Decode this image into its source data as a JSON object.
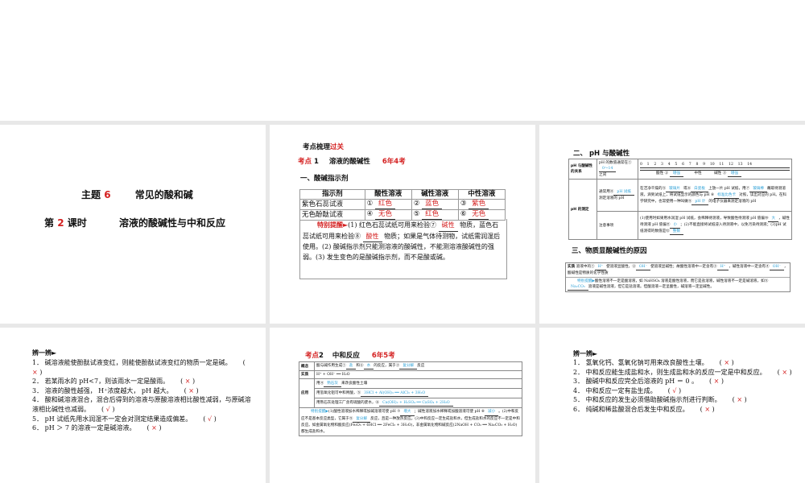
{
  "slides": {
    "s1": {
      "title_a": "主题",
      "title_num": "6",
      "title_b": "常见的酸和碱",
      "sub_a": "第",
      "sub_num": "2",
      "sub_b": "课时",
      "sub_c": "溶液的酸碱性与中和反应"
    },
    "s2": {
      "header_a": "考点梳理",
      "header_b": "过关",
      "kd_a": "考点",
      "kd_num": "1",
      "kd_title": "溶液的酸碱性",
      "kd_freq": "6年4考",
      "section": "一、酸碱指示剂",
      "table": {
        "headers": [
          "指示剂",
          "酸性溶液",
          "碱性溶液",
          "中性溶液"
        ],
        "rows": [
          {
            "name": "紫色石蕊试液",
            "c1n": "①",
            "c1": "红色",
            "c2n": "②",
            "c2": "蓝色",
            "c3n": "③",
            "c3": "紫色"
          },
          {
            "name": "无色酚酞试液",
            "c1n": "④",
            "c1": "无色",
            "c2n": "⑤",
            "c2": "红色",
            "c3n": "⑥",
            "c3": "无色"
          }
        ]
      },
      "note_label": "特别提醒►",
      "note_a": "(1) 红色石蕊试纸可用来检验⑦",
      "note_ans1": "碱性",
      "note_b": "物质，蓝色石蕊试纸可用来检验⑧",
      "note_ans2": "酸性",
      "note_c": "物质；如果是气体待测物，试纸需润湿后使用。(2) 酸碱指示剂只能测溶液的酸碱性，不能测溶液酸碱性的强弱。(3) 发生变色的是酸碱指示剂，而不是酸或碱。"
    },
    "s3": {
      "section1": "二、 pH 与酸碱性",
      "row1_head": "pH 与酸碱性的关系",
      "row1_text_a": "pH 的数值通常在①",
      "row1_ans": "0～14",
      "row1_text_b": "之间",
      "scale": "0 1 2 3 4 5 6 7 8 9 10 11 12 13 14",
      "scale_acid": "酸性 ②",
      "scale_acid_ans": "增强",
      "scale_neutral": "中性",
      "scale_base": "碱性 ③",
      "scale_base_ans": "增强",
      "row2_head": "pH 的测定",
      "row2_mid_a": "通常用④",
      "row2_mid_ans": "pH 试纸",
      "row2_mid_b": "测定溶液的 pH",
      "row2_text_a": "在洁净干燥的⑤",
      "row2_ans5": "玻璃片",
      "row2_text_b": "或⑥",
      "row2_ans6": "白瓷板",
      "row2_text_c": "上放一片 pH 试纸，用⑦",
      "row2_ans7": "玻璃棒",
      "row2_text_d": "蘸取待测溶液，滴到试纸上，将试纸显示的颜色与 pH ⑧",
      "row2_ans8": "标准比色卡",
      "row2_text_e": "对照，读出对应的 pH。在科学研究中，也常使用一种叫做⑨",
      "row2_ans9": "pH 计",
      "row2_text_f": "的电子仪器来测定溶液的 pH",
      "row3_mid": "注意事项",
      "row3_text_a": "(1)使用时如果用水润湿 pH 试纸，会稀释待测液，导致酸性待测液 pH 值偏⑩",
      "row3_ans10": "大",
      "row3_text_b": "，碱性待测液 pH 值偏⑪",
      "row3_ans11": "小",
      "row3_text_c": "；(2)不能直接将试纸浸入待测液中，以免污染待测液；(3)pH 试纸测得的数值是⑫",
      "row3_ans12": "整数",
      "section2": "三、物质显酸碱性的原因",
      "essence_head": "实质",
      "essence_a": "溶液中的①",
      "ans1": "H⁺",
      "essence_b": "使溶液显酸性，②",
      "ans2": "OH⁻",
      "essence_c": "使溶液显碱性；故酸性溶液中一定含有③",
      "ans3": "H⁺",
      "essence_d": "，碱性溶液中一定含有④",
      "ans4": "OH⁻",
      "essence_e": "，酸碱性是物质的化学性质",
      "tip_label": "特别提醒▶",
      "tip_a": "酸性溶液不一定是酸溶液，如 NaHSO₄ 溶液是酸性溶液，而它是盐溶液，碱性溶液不一定是碱溶液，如⑤",
      "tip_ans": "Na₂CO₃",
      "tip_b": "溶液是碱性溶液，但它是盐溶液。但酸溶液一定呈酸性，碱溶液一定呈碱性。"
    },
    "s4": {
      "title": "辨一辨►",
      "items": [
        {
          "text": "1． 碱溶液能使酚酞试液变红，则能使酚酞试液变红的物质一定是碱。",
          "mark": "×"
        },
        {
          "text": "2． 若某雨水的 pH<7，则该雨水一定是酸雨。",
          "mark": "×"
        },
        {
          "text": "3． 溶液的酸性越强， H⁺浓度越大， pH 越大。",
          "mark": "×"
        },
        {
          "text": "4． 酸和碱溶液混合，混合后得到的溶液与原酸溶液相比酸性减弱，与原碱溶液相比碱性也减弱。",
          "mark": "√"
        },
        {
          "text": "5． pH 试纸先用水润湿不一定会对测定结果造成偏差。",
          "mark": "√"
        },
        {
          "text": "6． pH ＞ 7 的溶液一定是碱溶液。",
          "mark": "×"
        }
      ]
    },
    "s5": {
      "kd_a": "考点",
      "kd_num": "2",
      "kd_title": "中和反应",
      "kd_freq": "6年5考",
      "concept_head": "概念",
      "concept_a": "酸与碱作用生成①",
      "ans1": "盐",
      "concept_b": "和②",
      "ans2": "水",
      "concept_c": "的反应，属于③",
      "ans3": "复分解",
      "concept_d": "反应",
      "essence_head": "实质",
      "essence": "H⁺ + OH⁻ ══ H₂O",
      "apply_head": "应用",
      "apply1_a": "用④",
      "apply1_ans": "熟石灰",
      "apply1_b": "来改良酸性土壤",
      "apply2_a": "用氢氧化铝可中和胃酸，⑤",
      "apply2_ans": "3HCl + Al(OH)₃ ══ AlCl₃ + 3H₂O",
      "apply3_a": "用熟石灰处理工厂含有硫酸的废水，⑥",
      "apply3_ans": "Ca(OH)₂ + H₂SO₄ ══ CaSO₄ + 2H₂O",
      "tip_label": "特别提醒▶",
      "tip_a": "(1)酸性溶液加水稀释或加碱溶液可使 pH ⑦",
      "tip_ans7": "增大",
      "tip_b": "；碱性溶液加水稀释或加酸溶液可使 pH ⑧",
      "tip_ans8": "减小",
      "tip_c": "。(2)中和反应不是基本反应类型，它属于⑨",
      "tip_ans9": "复分解",
      "tip_d": "反应，且是一种放热反应。(3)中和反应一定生成盐和水，但生成盐和水的反应不一定是中和反应。如金属氧化物和酸反应(Fe₂O₃ + 6HCl ══ 2FeCl₃ + 3H₂O)，非金属氧化物和碱反应(2NaOH + CO₂ ══ Na₂CO₃ + H₂O)都生成盐和水。"
    },
    "s6": {
      "title": "辨一辨►",
      "items": [
        {
          "text": "1． 氢氧化钙、氢氧化钠可用来改良酸性土壤。",
          "mark": "×"
        },
        {
          "text": "2． 中和反应能生成盐和水，则生成盐和水的反应一定是中和反应。",
          "mark": "×"
        },
        {
          "text": "3． 酸碱中和反应完全后溶液的 pH ＝ 0 。",
          "mark": "×"
        },
        {
          "text": "4． 中和反应一定有盐生成。",
          "mark": "√"
        },
        {
          "text": "5． 中和反应的发生必须借助酸碱指示剂进行判断。",
          "mark": "×"
        },
        {
          "text": "6． 纯碱和稀盐酸混合后发生中和反应。",
          "mark": "×"
        }
      ]
    }
  }
}
